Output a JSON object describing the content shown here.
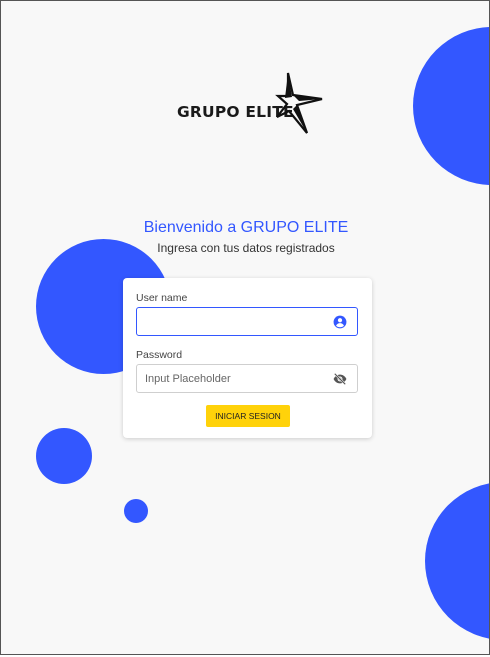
{
  "brand": {
    "logo_text": "GRUPO ELITE",
    "accent_color": "#3357ff",
    "button_color": "#ffd20a"
  },
  "header": {
    "welcome": "Bienvenido a GRUPO ELITE",
    "subtitle": "Ingresa con tus datos registrados"
  },
  "form": {
    "username_label": "User name",
    "username_value": "",
    "username_icon": "account-circle-icon",
    "password_label": "Password",
    "password_placeholder": "Input Placeholder",
    "password_icon": "eye-off-icon",
    "submit_label": "INICIAR SESION"
  }
}
